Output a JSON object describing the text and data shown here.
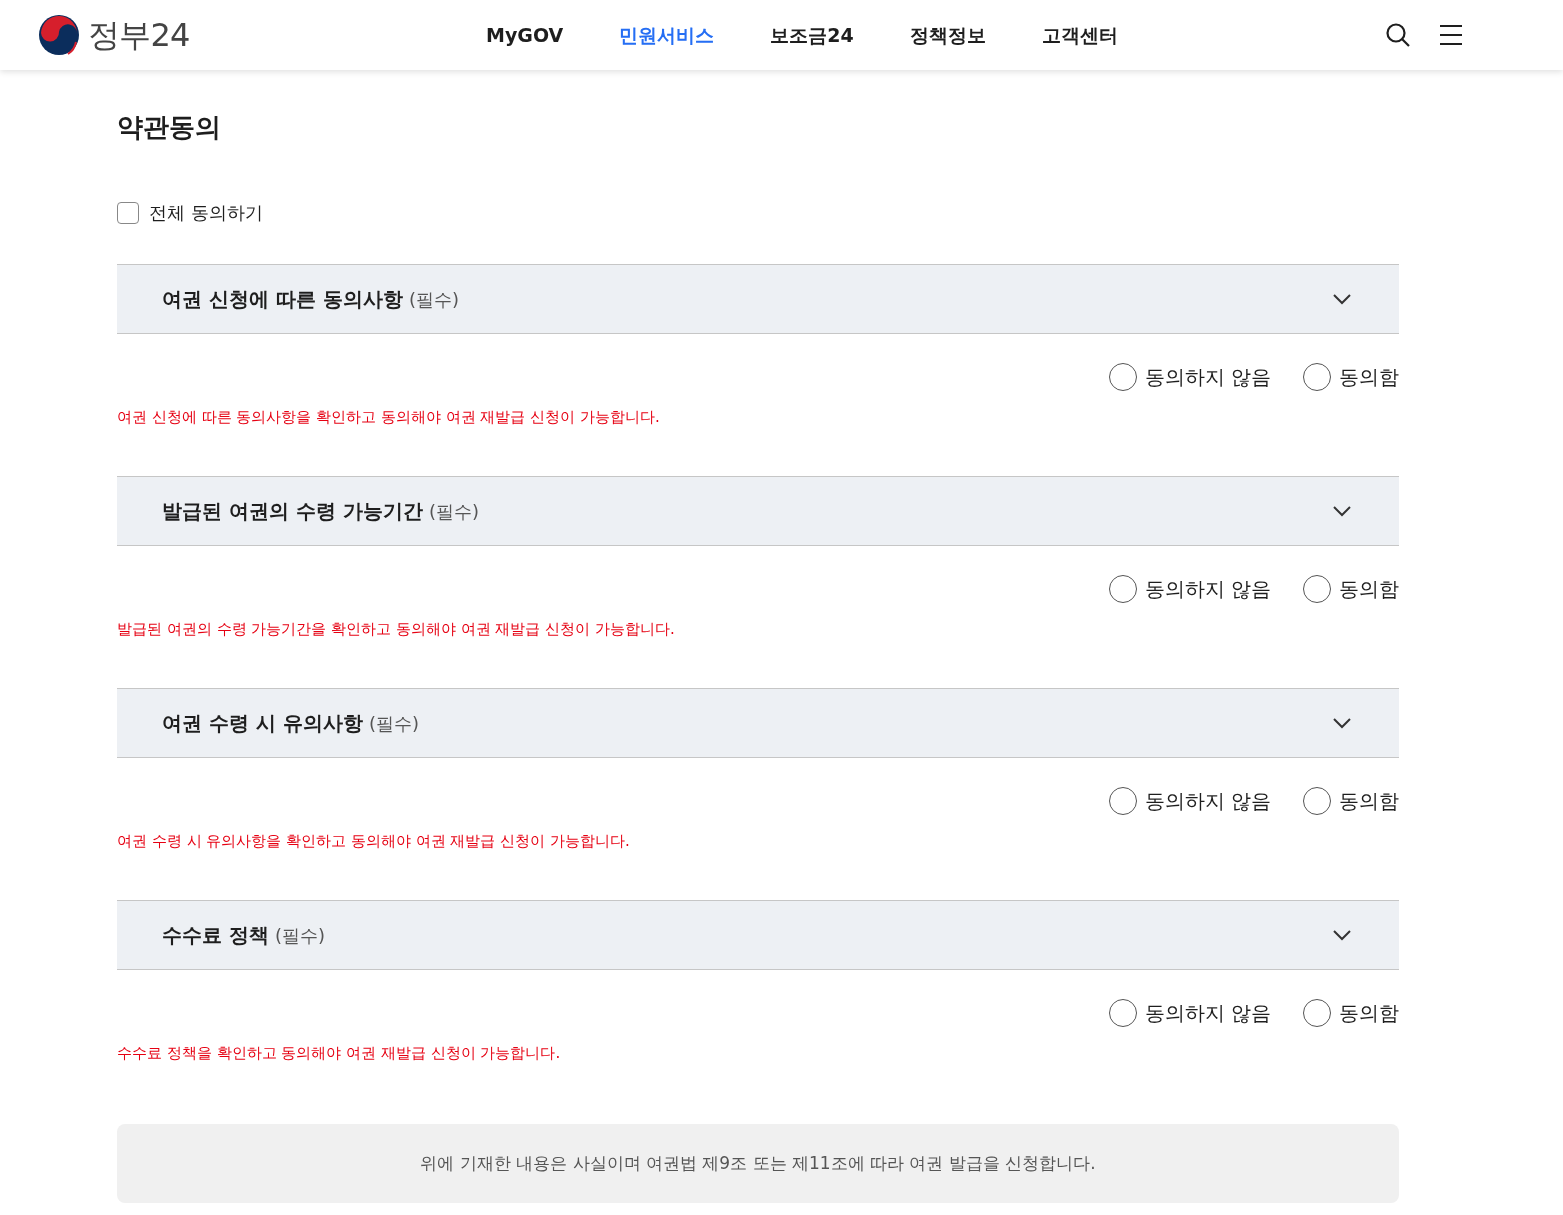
{
  "header": {
    "logo_text": "정부24",
    "nav": [
      {
        "label": "MyGOV",
        "selected": false
      },
      {
        "label": "민원서비스",
        "selected": true
      },
      {
        "label": "보조금24",
        "selected": false
      },
      {
        "label": "정책정보",
        "selected": false
      },
      {
        "label": "고객센터",
        "selected": false
      }
    ]
  },
  "title": "약관동의",
  "agree_all": {
    "label": "전체 동의하기",
    "checked": false
  },
  "sections": [
    {
      "title": "여권 신청에 따른 동의사항",
      "tag": "(필수)",
      "options": [
        {
          "label": "동의하지 않음",
          "selected": false
        },
        {
          "label": "동의함",
          "selected": false
        }
      ],
      "message": "여권 신청에 따른 동의사항을 확인하고 동의해야 여권 재발급 신청이 가능합니다."
    },
    {
      "title": "발급된 여권의 수령 가능기간",
      "tag": "(필수)",
      "options": [
        {
          "label": "동의하지 않음",
          "selected": false
        },
        {
          "label": "동의함",
          "selected": false
        }
      ],
      "message": "발급된 여권의 수령 가능기간을 확인하고 동의해야 여권 재발급 신청이 가능합니다."
    },
    {
      "title": "여권 수령 시 유의사항",
      "tag": "(필수)",
      "options": [
        {
          "label": "동의하지 않음",
          "selected": false
        },
        {
          "label": "동의함",
          "selected": false
        }
      ],
      "message": "여권 수령 시 유의사항을 확인하고 동의해야 여권 재발급 신청이 가능합니다."
    },
    {
      "title": "수수료 정책",
      "tag": "(필수)",
      "options": [
        {
          "label": "동의하지 않음",
          "selected": false
        },
        {
          "label": "동의함",
          "selected": false
        }
      ],
      "message": "수수료 정책을 확인하고 동의해야 여권 재발급 신청이 가능합니다."
    }
  ],
  "notice": "위에 기재한 내용은 사실이며 여권법 제9조 또는 제11조에 따라 여권 발급을 신청합니다."
}
